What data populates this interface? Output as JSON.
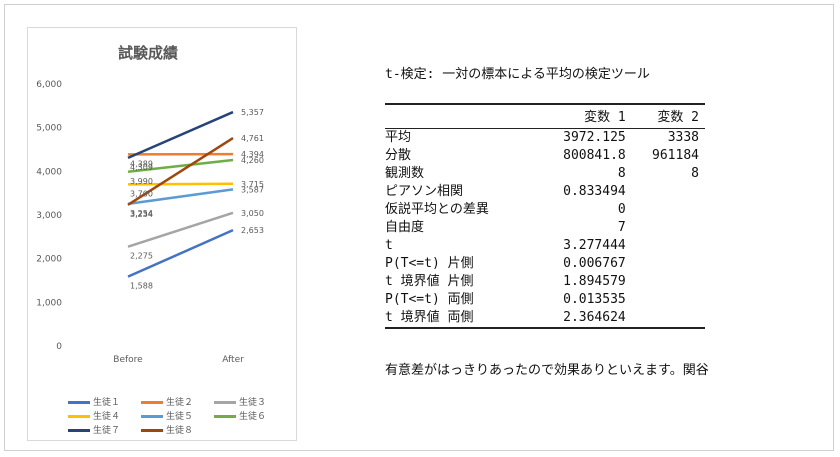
{
  "chart_data": {
    "type": "line",
    "title": "試験成績",
    "categories": [
      "Before",
      "After"
    ],
    "yticks": [
      "0",
      "1,000",
      "2,000",
      "3,000",
      "4,000",
      "5,000",
      "6,000"
    ],
    "ylim": [
      0,
      6000
    ],
    "grid": false,
    "legend_position": "bottom",
    "series": [
      {
        "name": "生徒１",
        "values": [
          1588,
          2653
        ],
        "labels": [
          "1,588",
          "2,653"
        ],
        "color": "#4472C4"
      },
      {
        "name": "生徒２",
        "values": [
          4389,
          4394
        ],
        "labels": [
          "4,389",
          "4,394"
        ],
        "color": "#ED7D31"
      },
      {
        "name": "生徒３",
        "values": [
          2275,
          3050
        ],
        "labels": [
          "2,275",
          "3,050"
        ],
        "color": "#A5A5A5"
      },
      {
        "name": "生徒４",
        "values": [
          3700,
          3715
        ],
        "labels": [
          "3,700",
          "3,715"
        ],
        "color": "#FFC000"
      },
      {
        "name": "生徒５",
        "values": [
          3254,
          3587
        ],
        "labels": [
          "3,254",
          "3,587"
        ],
        "color": "#5B9BD5"
      },
      {
        "name": "生徒６",
        "values": [
          3990,
          4260
        ],
        "labels": [
          "3,990",
          "4,260"
        ],
        "color": "#70AD47"
      },
      {
        "name": "生徒７",
        "values": [
          4309,
          5357
        ],
        "labels": [
          "4,309",
          "5,357"
        ],
        "color": "#264478"
      },
      {
        "name": "生徒８",
        "values": [
          3234,
          4761
        ],
        "labels": [
          "3,234",
          "4,761"
        ],
        "color": "#9E480E"
      }
    ]
  },
  "stats": {
    "title": "t-検定: 一対の標本による平均の検定ツール",
    "headers": [
      "",
      "変数 1",
      "変数 2"
    ],
    "rows": [
      [
        "平均",
        "3972.125",
        "3338"
      ],
      [
        "分散",
        "800841.8",
        "961184"
      ],
      [
        "観測数",
        "8",
        "8"
      ],
      [
        "ピアソン相関",
        "0.833494",
        ""
      ],
      [
        "仮説平均との差異",
        "0",
        ""
      ],
      [
        "自由度",
        "7",
        ""
      ],
      [
        "t",
        "3.277444",
        ""
      ],
      [
        "P(T<=t) 片側",
        "0.006767",
        ""
      ],
      [
        "t 境界値 片側",
        "1.894579",
        ""
      ],
      [
        "P(T<=t) 両側",
        "0.013535",
        ""
      ],
      [
        "t 境界値 両側",
        "2.364624",
        ""
      ]
    ],
    "note": "有意差がはっきりあったので効果ありといえます。関谷"
  }
}
